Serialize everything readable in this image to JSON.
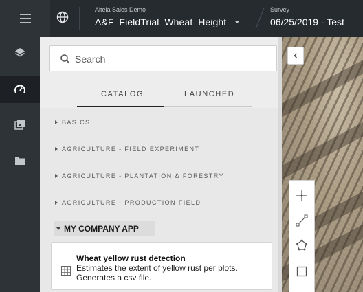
{
  "topbar": {
    "menu_icon": "hamburger-icon",
    "globe_icon": "globe-icon",
    "project_label": "Alteia Sales Demo",
    "project_name": "A&F_FieldTrial_Wheat_Height",
    "survey_label": "Survey",
    "survey_value": "06/25/2019 - Test"
  },
  "rail": {
    "items": [
      {
        "icon": "layers-icon",
        "active": false
      },
      {
        "icon": "gauge-icon",
        "active": true
      },
      {
        "icon": "gallery-icon",
        "active": false
      },
      {
        "icon": "folder-icon",
        "active": false
      }
    ]
  },
  "search": {
    "placeholder": "Search"
  },
  "tabs": {
    "catalog": "CATALOG",
    "launched": "LAUNCHED",
    "active": "catalog"
  },
  "categories": [
    {
      "label": "BASICS"
    },
    {
      "label": "AGRICULTURE - FIELD EXPERIMENT"
    },
    {
      "label": "AGRICULTURE - PLANTATION & FORESTRY"
    },
    {
      "label": "AGRICULTURE - PRODUCTION FIELD"
    }
  ],
  "group": {
    "label": "MY COMPANY APP",
    "app": {
      "title": "Wheat yellow rust detection",
      "description": "Estimates the extent of yellow rust per plots. Generates a csv file."
    }
  },
  "map_tools": [
    {
      "icon": "crosshair-icon"
    },
    {
      "icon": "polyline-icon"
    },
    {
      "icon": "polygon-icon"
    },
    {
      "icon": "rectangle-icon"
    }
  ]
}
